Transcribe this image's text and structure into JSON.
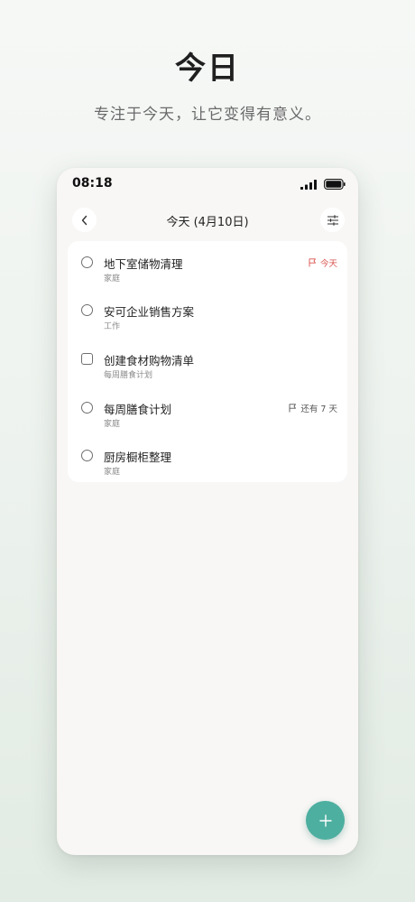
{
  "hero": {
    "title": "今日",
    "subtitle": "专注于今天，让它变得有意义。"
  },
  "status_bar": {
    "time": "08:18"
  },
  "nav": {
    "title": "今天 (4月10日)",
    "back_icon": "chevron-left-icon",
    "filter_icon": "sliders-icon"
  },
  "tasks": [
    {
      "title": "地下室储物清理",
      "category": "家庭",
      "check": "circle",
      "tag": "今天",
      "tag_color": "#d9534f"
    },
    {
      "title": "安可企业销售方案",
      "category": "工作",
      "check": "circle",
      "tag": "",
      "tag_color": ""
    },
    {
      "title": "创建食材购物清单",
      "category": "每周膳食计划",
      "check": "square",
      "tag": "",
      "tag_color": ""
    },
    {
      "title": "每周膳食计划",
      "category": "家庭",
      "check": "circle",
      "tag": "还有 7 天",
      "tag_color": "#555555"
    },
    {
      "title": "厨房橱柜整理",
      "category": "家庭",
      "check": "circle",
      "tag": "",
      "tag_color": ""
    }
  ],
  "fab": {
    "icon": "plus-icon"
  },
  "colors": {
    "accent": "#4dafa0",
    "due_today": "#d9534f"
  }
}
